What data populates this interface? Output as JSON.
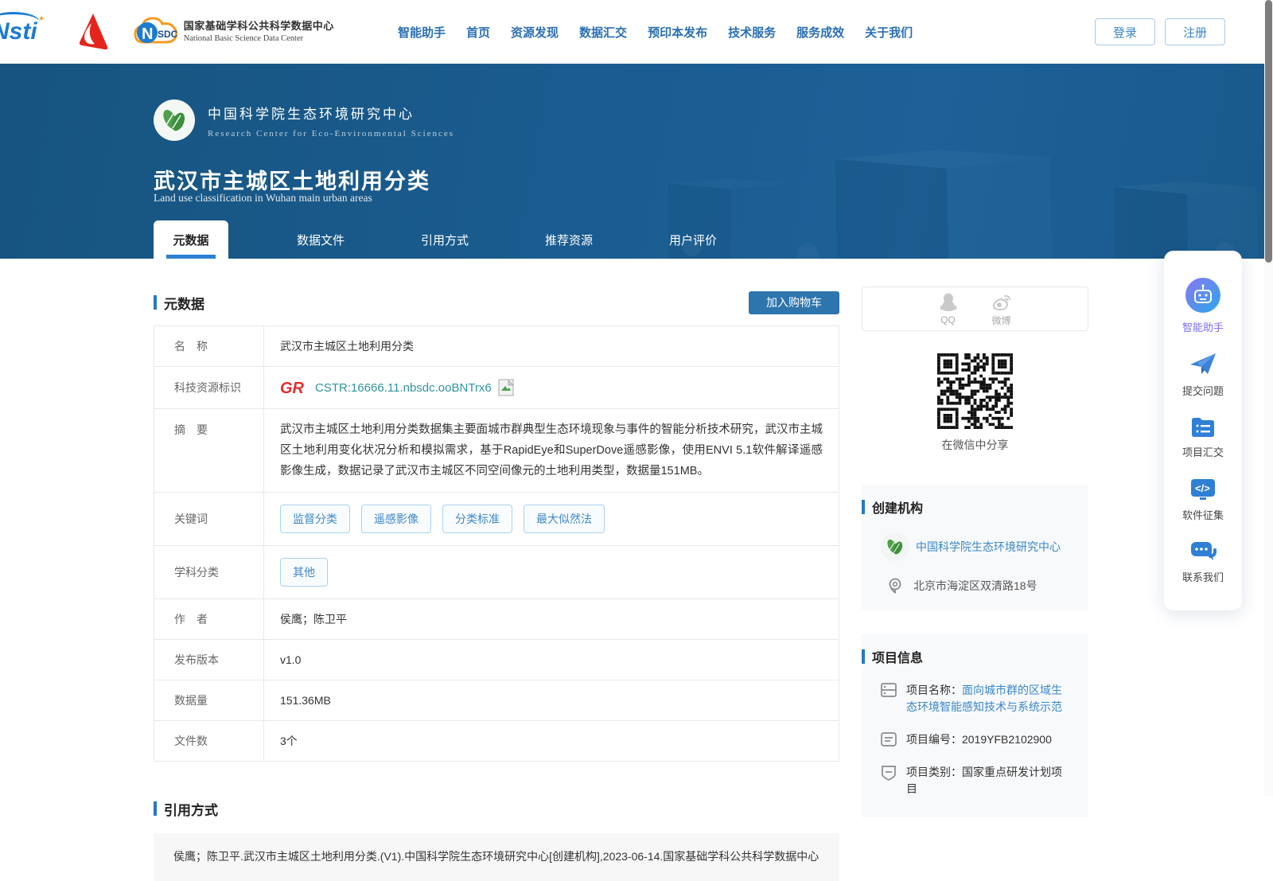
{
  "colors": {
    "accent": "#2878be",
    "banner": "#1a5c90",
    "link": "#3a87c8",
    "nav": "#2b6fb3",
    "cstr": "#2e95a3",
    "button": "#2e75ae",
    "tag_border": "#a8d2f0"
  },
  "header": {
    "nbsdc_name_cn": "国家基础学科公共科学数据中心",
    "nbsdc_name_en": "National Basic Science Data Center",
    "nav": [
      "智能助手",
      "首页",
      "资源发现",
      "数据汇交",
      "预印本发布",
      "技术服务",
      "服务成效",
      "关于我们"
    ],
    "login": "登录",
    "register": "注册"
  },
  "banner": {
    "org_cn": "中国科学院生态环境研究中心",
    "org_en": "Research Center for Eco-Environmental Sciences",
    "title": "武汉市主城区土地利用分类",
    "subtitle": "Land use classification in Wuhan main urban areas",
    "tabs": [
      {
        "label": "元数据",
        "active": true
      },
      {
        "label": "数据文件",
        "active": false
      },
      {
        "label": "引用方式",
        "active": false
      },
      {
        "label": "推荐资源",
        "active": false
      },
      {
        "label": "用户评价",
        "active": false
      }
    ]
  },
  "metadata": {
    "section_title": "元数据",
    "add_to_cart": "加入购物车",
    "name": {
      "label": "名　称",
      "value": "武汉市主城区土地利用分类"
    },
    "cstr": {
      "label": "科技资源标识",
      "value": "CSTR:16666.11.nbsdc.ooBNTrx6"
    },
    "abstract": {
      "label": "摘　要",
      "value": "武汉市主城区土地利用分类数据集主要面城市群典型生态环境现象与事件的智能分析技术研究，武汉市主城区土地利用变化状况分析和模拟需求，基于RapidEye和SuperDove遥感影像，使用ENVI 5.1软件解译遥感影像生成，数据记录了武汉市主城区不同空间像元的土地利用类型，数据量151MB。"
    },
    "keywords": {
      "label": "关键词",
      "tags": [
        "监督分类",
        "遥感影像",
        "分类标准",
        "最大似然法"
      ]
    },
    "subject": {
      "label": "学科分类",
      "tags": [
        "其他"
      ]
    },
    "author": {
      "label": "作　者",
      "value": "侯鹰；陈卫平"
    },
    "version": {
      "label": "发布版本",
      "value": "v1.0"
    },
    "size": {
      "label": "数据量",
      "value": "151.36MB"
    },
    "files": {
      "label": "文件数",
      "value": "3个"
    }
  },
  "citation": {
    "section_title": "引用方式",
    "text": "侯鹰；陈卫平.武汉市主城区土地利用分类.(V1).中国科学院生态环境研究中心[创建机构],2023-06-14.国家基础学科公共科学数据中心"
  },
  "share": {
    "qq": "QQ",
    "weibo": "微博",
    "wechat_caption": "在微信中分享"
  },
  "creator": {
    "section_title": "创建机构",
    "org": "中国科学院生态环境研究中心",
    "address": "北京市海淀区双清路18号"
  },
  "project": {
    "section_title": "项目信息",
    "name_label": "项目名称：",
    "name": "面向城市群的区域生态环境智能感知技术与系统示范",
    "code_label": "项目编号：",
    "code": "2019YFB2102900",
    "type_label": "项目类别：",
    "type": "国家重点研发计划项目"
  },
  "float_panel": {
    "items": [
      {
        "label": "智能助手",
        "icon": "robot-icon"
      },
      {
        "label": "提交问题",
        "icon": "paper-plane-icon"
      },
      {
        "label": "项目汇交",
        "icon": "folder-list-icon"
      },
      {
        "label": "软件征集",
        "icon": "code-monitor-icon"
      },
      {
        "label": "联系我们",
        "icon": "chat-bubbles-icon"
      }
    ]
  }
}
